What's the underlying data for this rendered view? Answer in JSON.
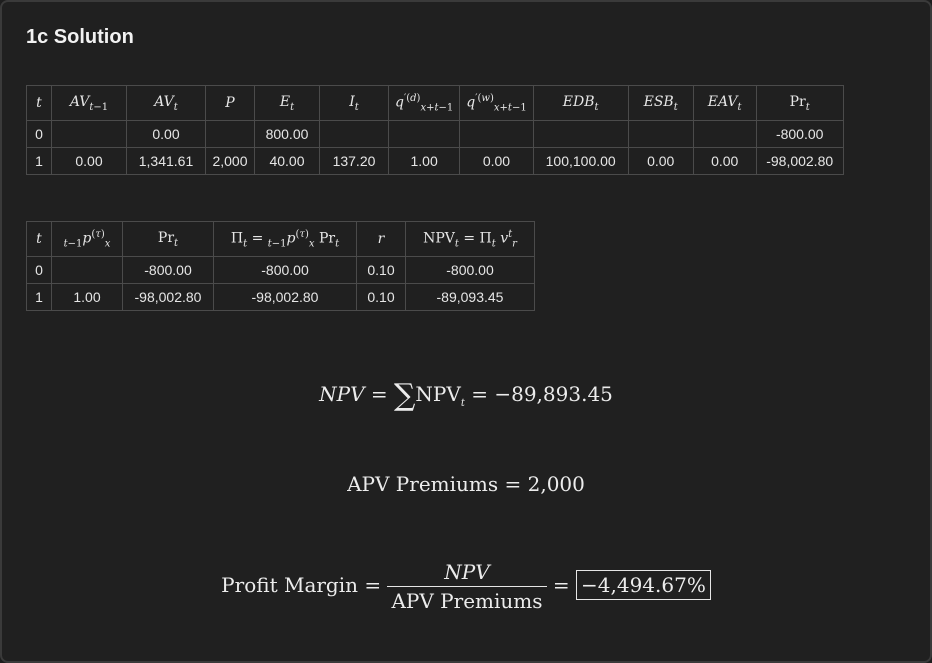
{
  "heading": "1c Solution",
  "table1": {
    "rows": [
      [
        "0",
        "",
        "0.00",
        "",
        "800.00",
        "",
        "",
        "",
        "",
        "",
        "",
        "-800.00"
      ],
      [
        "1",
        "0.00",
        "1,341.61",
        "2,000",
        "40.00",
        "137.20",
        "1.00",
        "0.00",
        "100,100.00",
        "0.00",
        "0.00",
        "-98,002.80"
      ]
    ]
  },
  "table2": {
    "rows": [
      [
        "0",
        "",
        "-800.00",
        "-800.00",
        "0.10",
        "-800.00"
      ],
      [
        "1",
        "1.00",
        "-98,002.80",
        "-98,002.80",
        "0.10",
        "-89,093.45"
      ]
    ]
  },
  "formulas": {
    "npv_value": "−89,893.45",
    "apv_value": "2,000",
    "profit_margin_value": "−4,494.67%"
  }
}
